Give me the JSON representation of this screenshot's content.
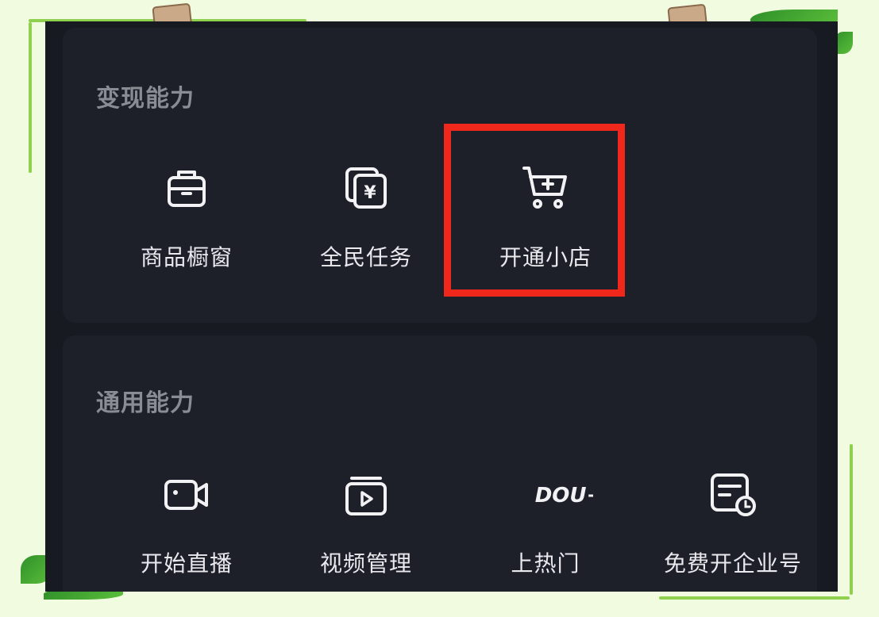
{
  "monetization": {
    "title": "变现能力",
    "items": [
      {
        "label": "商品橱窗",
        "icon": "briefcase-icon"
      },
      {
        "label": "全民任务",
        "icon": "yen-cards-icon"
      },
      {
        "label": "开通小店",
        "icon": "cart-plus-icon"
      }
    ]
  },
  "general": {
    "title": "通用能力",
    "items": [
      {
        "label": "开始直播",
        "icon": "video-camera-icon"
      },
      {
        "label": "视频管理",
        "icon": "video-library-icon"
      },
      {
        "label": "上热门",
        "icon": "dou-plus-icon",
        "icon_text": "DOU+"
      },
      {
        "label": "免费开企业号",
        "icon": "document-clock-icon"
      }
    ]
  },
  "colors": {
    "highlight": "#f0281b",
    "panel": "#181a22",
    "page_background": "#f1fbdf"
  }
}
